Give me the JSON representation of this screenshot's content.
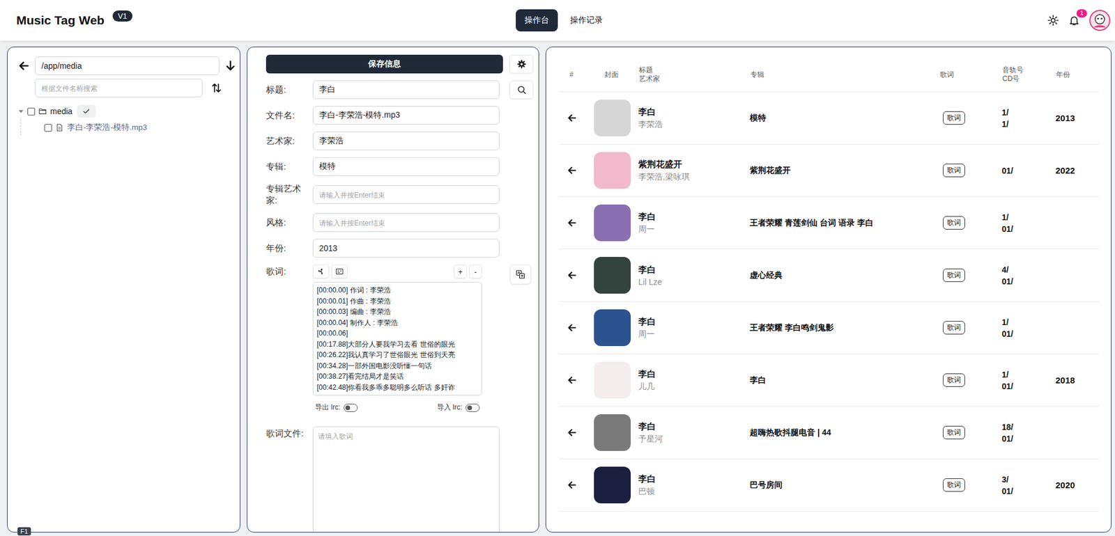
{
  "header": {
    "title": "Music Tag Web",
    "version": "V1",
    "tabs": [
      {
        "label": "操作台",
        "selected": true
      },
      {
        "label": "操作记录",
        "selected": false
      }
    ],
    "notification_count": "1"
  },
  "files": {
    "path": "/app/media",
    "search_placeholder": "根据文件名称搜索",
    "tree": [
      {
        "name": "media",
        "kind": "folder",
        "depth": 0,
        "expanded": true,
        "checked": false
      },
      {
        "name": "李白-李荣浩-模特.mp3",
        "kind": "file",
        "depth": 1,
        "expanded": false,
        "checked": false
      }
    ]
  },
  "editor": {
    "save_label": "保存信息",
    "fields": [
      {
        "label": "标题:",
        "value": "李白",
        "placeholder": "",
        "search": true
      },
      {
        "label": "文件名:",
        "value": "李白-李荣浩-模特.mp3",
        "placeholder": "",
        "search": false
      },
      {
        "label": "艺术家:",
        "value": "李荣浩",
        "placeholder": "",
        "search": false
      },
      {
        "label": "专辑:",
        "value": "模特",
        "placeholder": "",
        "search": false
      },
      {
        "label": "专辑艺术家:",
        "value": "",
        "placeholder": "请输入并按Enter结束",
        "search": false
      },
      {
        "label": "风格:",
        "value": "",
        "placeholder": "请输入并按Enter结束",
        "search": false
      },
      {
        "label": "年份:",
        "value": "2013",
        "placeholder": "",
        "search": false
      }
    ],
    "lyrics": {
      "label": "歌词:",
      "tools": [
        "+",
        "-"
      ],
      "lines": [
        "[00:00.00] 作词 : 李荣浩",
        "[00:00.01] 作曲 : 李荣浩",
        "[00:00.03] 编曲 : 李荣浩",
        "[00:00.04] 制作人 : 李荣浩",
        "[00:00.06]",
        "[00:17.88]大部分人要我学习去看 世俗的眼光",
        "[00:26.22]我认真学习了世俗眼光 世俗到天亮",
        "[00:34.28]一部外国电影没听懂一句话",
        "[00:38.27]看完结局才是笑话",
        "[00:42.48]你看我多乖多聪明多么听话 多奸诈"
      ],
      "toggles": [
        {
          "label": "导出 lrc:",
          "on": false
        },
        {
          "label": "导入 lrc:",
          "on": false
        }
      ]
    },
    "lyric_file": {
      "label": "歌词文件:",
      "placeholder": "请填入歌词",
      "value": ""
    }
  },
  "table": {
    "columns": [
      {
        "lines": [
          "#"
        ]
      },
      {
        "lines": [
          "封面"
        ]
      },
      {
        "lines": [
          "标题",
          "艺术家"
        ]
      },
      {
        "lines": [
          "专辑"
        ]
      },
      {
        "lines": [
          "歌词"
        ]
      },
      {
        "lines": [
          "音轨号",
          "CD号"
        ]
      },
      {
        "lines": [
          "年份"
        ]
      }
    ],
    "lyric_button": "歌词",
    "rows": [
      {
        "title": "李白",
        "artist": "李荣浩",
        "album": "模特",
        "track": "1/",
        "disc": "1/",
        "year": "2013",
        "color": "#d6d6d6"
      },
      {
        "title": "紫荆花盛开",
        "artist": "李荣浩,梁咏琪",
        "album": "紫荆花盛开",
        "track": "01/",
        "disc": "",
        "year": "2022",
        "color": "#f2b8cb"
      },
      {
        "title": "李白",
        "artist": "周一",
        "album": "王者荣耀 青莲剑仙 台词 语录 李白",
        "track": "1/",
        "disc": "01/",
        "year": "",
        "color": "#8a70b2"
      },
      {
        "title": "李白",
        "artist": "Lil Lze",
        "album": "虚心经典",
        "track": "4/",
        "disc": "01/",
        "year": "",
        "color": "#33443e"
      },
      {
        "title": "李白",
        "artist": "周一",
        "album": "王者荣耀 李白鸣剑鬼影",
        "track": "1/",
        "disc": "01/",
        "year": "",
        "color": "#2c5290"
      },
      {
        "title": "李白",
        "artist": "儿几",
        "album": "李白",
        "track": "1/",
        "disc": "01/",
        "year": "2018",
        "color": "#f3eded"
      },
      {
        "title": "李白",
        "artist": "予星河",
        "album": "超嗨热歌抖腿电音 | 44",
        "track": "18/",
        "disc": "01/",
        "year": "",
        "color": "#7a7a7a"
      },
      {
        "title": "李白",
        "artist": "巴顿",
        "album": "巴号房间",
        "track": "3/",
        "disc": "01/",
        "year": "2020",
        "color": "#1c2040"
      }
    ]
  },
  "shortcut": "F1"
}
